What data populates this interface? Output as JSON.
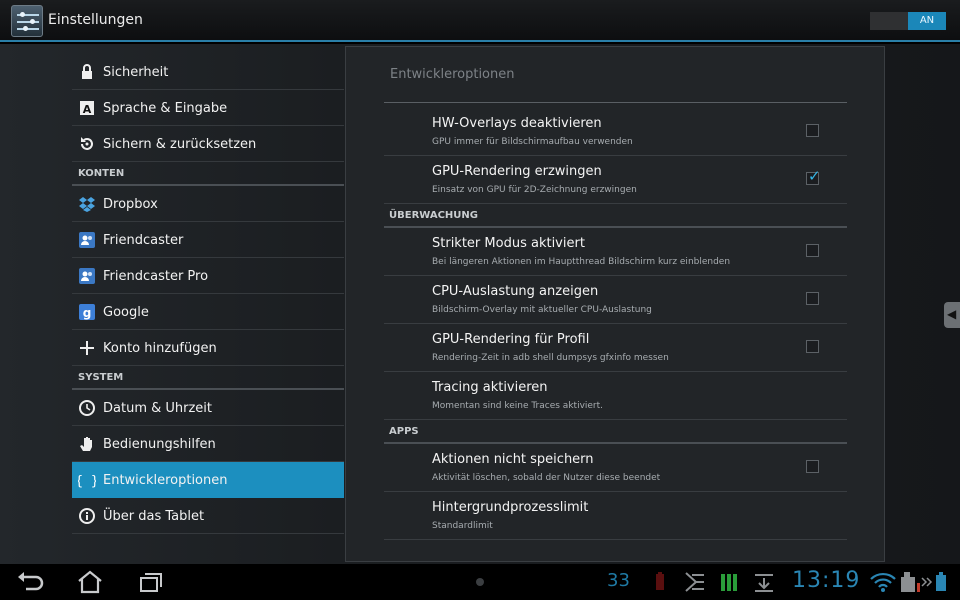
{
  "actionbar": {
    "title": "Einstellungen",
    "switch_label": "AN"
  },
  "sidebar": {
    "items_top": [
      {
        "label": "Sicherheit",
        "icon": "lock-icon"
      },
      {
        "label": "Sprache & Eingabe",
        "icon": "keyboard-a-icon"
      },
      {
        "label": "Sichern & zurücksetzen",
        "icon": "restore-icon"
      }
    ],
    "section_accounts": "KONTEN",
    "accounts": [
      {
        "label": "Dropbox",
        "icon": "dropbox-icon"
      },
      {
        "label": "Friendcaster",
        "icon": "friendcaster-icon"
      },
      {
        "label": "Friendcaster Pro",
        "icon": "friendcaster-pro-icon"
      },
      {
        "label": "Google",
        "icon": "google-icon"
      },
      {
        "label": "Konto hinzufügen",
        "icon": "plus-icon"
      }
    ],
    "section_system": "SYSTEM",
    "system": [
      {
        "label": "Datum & Uhrzeit",
        "icon": "clock-icon"
      },
      {
        "label": "Bedienungshilfen",
        "icon": "hand-icon"
      },
      {
        "label": "Entwickleroptionen",
        "icon": "braces-icon",
        "active": true
      },
      {
        "label": "Über das Tablet",
        "icon": "info-icon"
      }
    ]
  },
  "panel": {
    "title": "Entwickleroptionen",
    "rows_a": [
      {
        "title": "HW-Overlays deaktivieren",
        "summary": "GPU immer für Bildschirmaufbau verwenden",
        "checked": false
      },
      {
        "title": "GPU-Rendering erzwingen",
        "summary": "Einsatz von GPU für 2D-Zeichnung erzwingen",
        "checked": true
      }
    ],
    "section_monitor": "ÜBERWACHUNG",
    "rows_b": [
      {
        "title": "Strikter Modus aktiviert",
        "summary": "Bei längeren Aktionen im Hauptthread Bildschirm kurz einblenden",
        "checked": false
      },
      {
        "title": "CPU-Auslastung anzeigen",
        "summary": "Bildschirm-Overlay mit aktueller CPU-Auslastung",
        "checked": false
      },
      {
        "title": "GPU-Rendering für Profil",
        "summary": "Rendering-Zeit in adb shell dumpsys gfxinfo messen",
        "checked": false
      },
      {
        "title": "Tracing aktivieren",
        "summary": "Momentan sind keine Traces aktiviert."
      }
    ],
    "section_apps": "APPS",
    "rows_c": [
      {
        "title": "Aktionen nicht speichern",
        "summary": "Aktivität löschen, sobald der Nutzer diese beendet",
        "checked": false
      },
      {
        "title": "Hintergrundprozesslimit",
        "summary": "Standardlimit"
      }
    ]
  },
  "statusbar": {
    "notification_count": "33",
    "time": "13:19"
  },
  "colors": {
    "accent": "#33b5e5",
    "active_item": "#1c8fbf"
  }
}
